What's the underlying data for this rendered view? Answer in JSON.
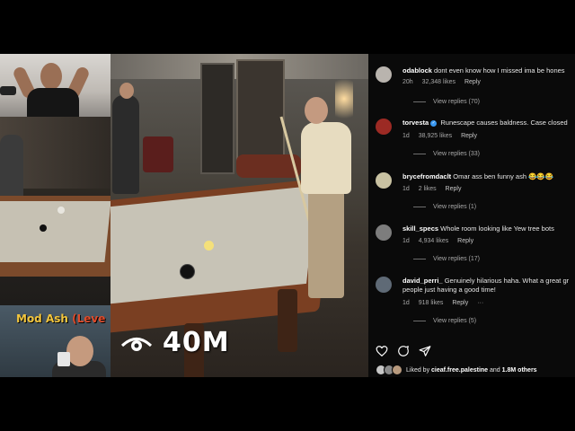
{
  "overlay": {
    "views_count": "40M",
    "cam_label_name": "Mod Ash",
    "cam_label_suffix": "(Leve"
  },
  "comments": [
    {
      "user": "odablock",
      "verified": false,
      "text": "dont even know how I missed ima be hones",
      "time": "20h",
      "likes": "32,348 likes",
      "reply": "Reply",
      "view_replies": "View replies (70)",
      "avatar_color": "#b9b4ae"
    },
    {
      "user": "torvesta",
      "verified": true,
      "text": "Runescape causes baldness. Case closed",
      "time": "1d",
      "likes": "38,925 likes",
      "reply": "Reply",
      "view_replies": "View replies (33)",
      "avatar_color": "#9c2a24"
    },
    {
      "user": "brycefromdaclt",
      "verified": false,
      "text": "Omar ass ben funny ash 😂😂😂",
      "time": "1d",
      "likes": "2 likes",
      "reply": "Reply",
      "view_replies": "View replies (1)",
      "avatar_color": "#c9c2a2"
    },
    {
      "user": "skill_specs",
      "verified": false,
      "text": "Whole room looking like Yew tree bots",
      "time": "1d",
      "likes": "4,934 likes",
      "reply": "Reply",
      "view_replies": "View replies (17)",
      "avatar_color": "#7d7d7d"
    },
    {
      "user": "david_perri_",
      "verified": false,
      "text": "Genuinely hilarious haha. What a great gr people just having a good time!",
      "time": "1d",
      "likes": "918 likes",
      "reply": "Reply",
      "more": "···",
      "view_replies": "View replies (5)",
      "avatar_color": "#5f6a76"
    }
  ],
  "liked_by": {
    "prefix": "Liked by",
    "user": "cieaf.free.palestine",
    "and": "and",
    "others": "1.8M others"
  },
  "icons": [
    "eye-icon",
    "heart-icon",
    "comment-icon",
    "share-icon",
    "verified-icon"
  ],
  "colors": {
    "panel_bg": "#0a0a0a",
    "verified": "#3897f0",
    "cam_label": "#f2c53d",
    "cam_label_level": "#e04b2a"
  }
}
